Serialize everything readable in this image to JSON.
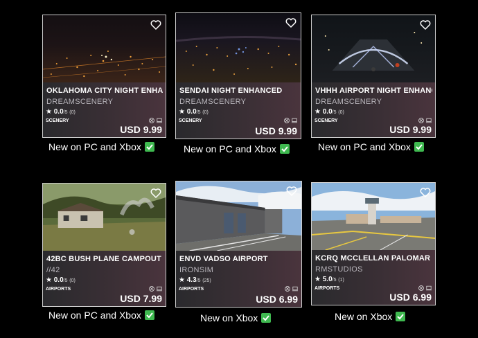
{
  "cards": [
    {
      "title": "OKLAHOMA CITY NIGHT ENHANCED",
      "publisher": "DREAMSCENERY",
      "score": "0.0",
      "of": "/5",
      "count": "(0)",
      "category": "SCENERY",
      "price": "USD 9.99",
      "caption": "New on PC and Xbox"
    },
    {
      "title": "SENDAI NIGHT ENHANCED",
      "publisher": "DREAMSCENERY",
      "score": "0.0",
      "of": "/5",
      "count": "(0)",
      "category": "SCENERY",
      "price": "USD 9.99",
      "caption": "New on PC and Xbox"
    },
    {
      "title": "VHHH AIRPORT NIGHT ENHANCED",
      "publisher": "DREAMSCENERY",
      "score": "0.0",
      "of": "/5",
      "count": "(0)",
      "category": "SCENERY",
      "price": "USD 9.99",
      "caption": "New on PC and Xbox"
    },
    {
      "title": "42BC BUSH PLANE CAMPOUT",
      "publisher": "//42",
      "score": "0.0",
      "of": "/5",
      "count": "(0)",
      "category": "AIRPORTS",
      "price": "USD 7.99",
      "caption": "New on PC and Xbox"
    },
    {
      "title": "ENVD VADSO AIRPORT",
      "publisher": "IRONSIM",
      "score": "4.3",
      "of": "/5",
      "count": "(25)",
      "category": "AIRPORTS",
      "price": "USD 6.99",
      "caption": "New on Xbox"
    },
    {
      "title": "KCRQ MCCLELLAN PALOMAR AIRPORT",
      "publisher": "RMSTUDIOS",
      "score": "5.0",
      "of": "/5",
      "count": "(1)",
      "category": "AIRPORTS",
      "price": "USD 6.99",
      "caption": "New on Xbox"
    }
  ],
  "icons": {
    "favorite": "heart-icon",
    "rating": "star-icon",
    "xbox": "xbox-icon",
    "pc": "pc-icon",
    "check": "check-icon"
  },
  "colors": {
    "check": "#3fb950",
    "border": "#cfcfcf"
  }
}
